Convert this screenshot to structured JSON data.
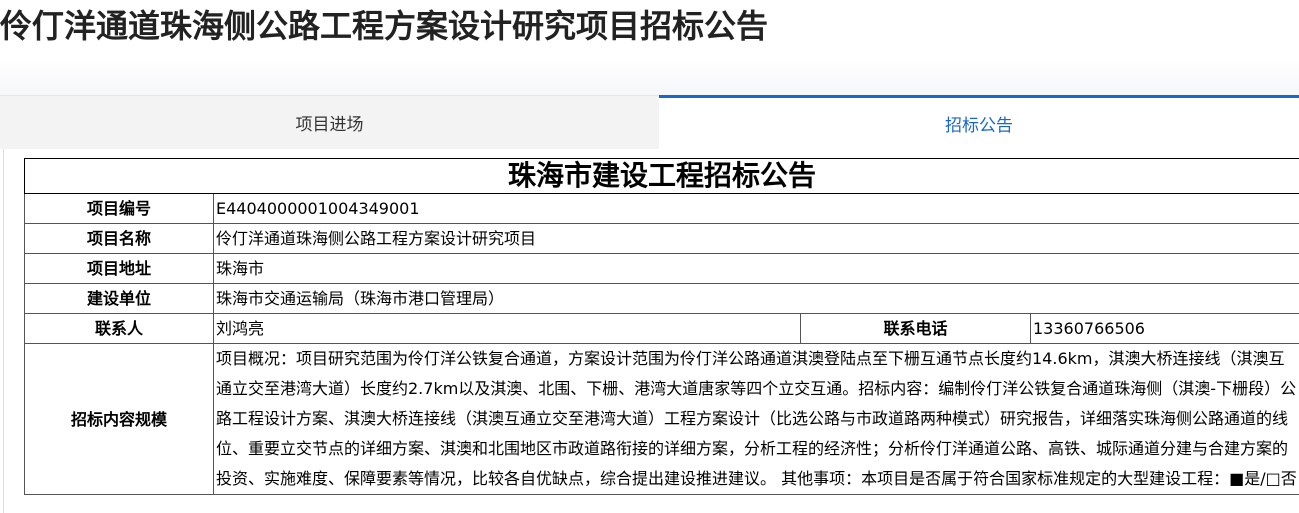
{
  "page_title": "伶仃洋通道珠海侧公路工程方案设计研究项目招标公告",
  "tabs": [
    {
      "label": "项目进场",
      "active": false
    },
    {
      "label": "招标公告",
      "active": true
    }
  ],
  "notice": {
    "title": "珠海市建设工程招标公告",
    "rows": {
      "project_no": {
        "label": "项目编号",
        "value": "E4404000001004349001"
      },
      "project_name": {
        "label": "项目名称",
        "value": "伶仃洋通道珠海侧公路工程方案设计研究项目"
      },
      "project_address": {
        "label": "项目地址",
        "value": "珠海市"
      },
      "builder": {
        "label": "建设单位",
        "value": "珠海市交通运输局（珠海市港口管理局）"
      },
      "contact": {
        "label": "联系人",
        "value": "刘鸿亮"
      },
      "phone": {
        "label": "联系电话",
        "value": "13360766506"
      },
      "scope": {
        "label": "招标内容规模",
        "value": "项目概况：项目研究范围为伶仃洋公铁复合通道，方案设计范围为伶仃洋公路通道淇澳登陆点至下栅互通节点长度约14.6km，淇澳大桥连接线（淇澳互通立交至港湾大道）长度约2.7km以及淇澳、北围、下栅、港湾大道唐家等四个立交互通。招标内容：编制伶仃洋公铁复合通道珠海侧（淇澳-下栅段）公路工程设计方案、淇澳大桥连接线（淇澳互通立交至港湾大道）工程方案设计（比选公路与市政道路两种模式）研究报告，详细落实珠海侧公路通道的线位、重要立交节点的详细方案、淇澳和北围地区市政道路衔接的详细方案，分析工程的经济性；分析伶仃洋通道公路、高铁、城际通道分建与合建方案的投资、实施难度、保障要素等情况，比较各自优缺点，综合提出建设推进建议。 其他事项：本项目是否属于符合国家标准规定的大型建设工程：■是/□否"
      }
    }
  },
  "colors": {
    "accent": "#1a66c9",
    "tab_inactive_bg": "#f3f3f3",
    "border": "#555555"
  }
}
